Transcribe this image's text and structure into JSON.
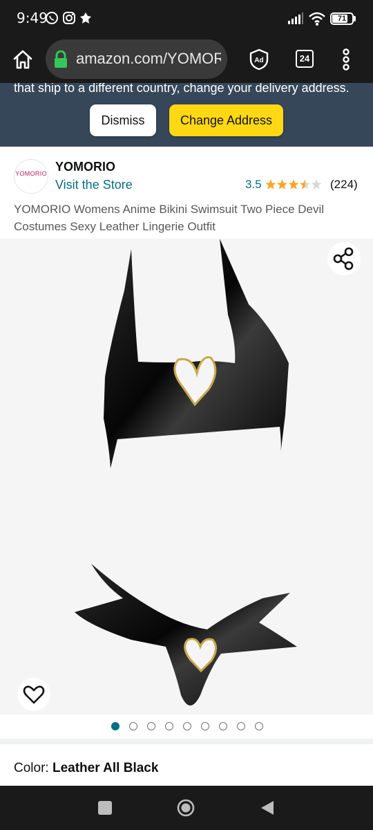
{
  "status": {
    "time": "9:49",
    "battery": "71"
  },
  "browser": {
    "url": "amazon.com/YOMOR",
    "tab_count": "24"
  },
  "banner": {
    "text": "that ship to a different country, change your delivery address.",
    "dismiss_label": "Dismiss",
    "change_label": "Change Address"
  },
  "product": {
    "logo_text": "YOMORIO",
    "brand": "YOMORIO",
    "store_link": "Visit the Store",
    "rating": "3.5",
    "rating_value": 3.5,
    "reviews": "(224)",
    "title": "YOMORIO Womens Anime Bikini Swimsuit Two Piece Devil Costumes Sexy Leather Lingerie Outfit",
    "image_count": 9,
    "active_image_index": 0
  },
  "color": {
    "label": "Color: ",
    "value": "Leather All Black"
  },
  "colors": {
    "banner_bg": "#37475a",
    "accent_yellow": "#ffd814",
    "link": "#007185",
    "star": "#ffa41c"
  },
  "icons": [
    "home-icon",
    "lock-icon",
    "adblock-icon",
    "tabs-icon",
    "more-icon",
    "share-icon",
    "heart-icon",
    "recents-icon",
    "home-circle-icon",
    "back-icon"
  ]
}
